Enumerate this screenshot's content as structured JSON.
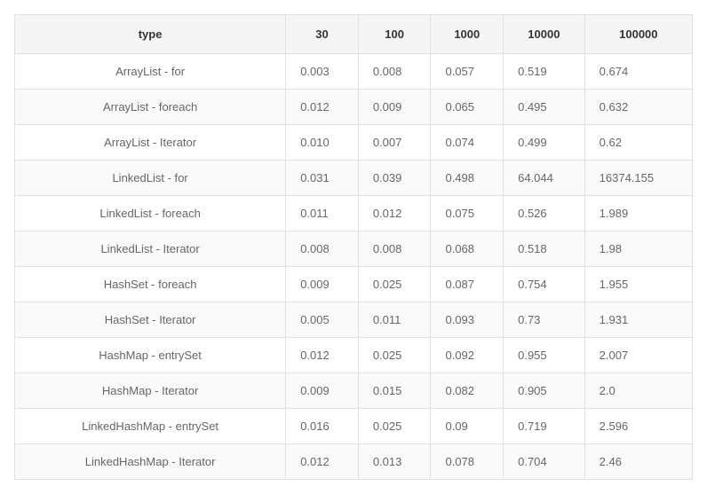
{
  "table": {
    "headers": [
      "type",
      "30",
      "100",
      "1000",
      "10000",
      "100000"
    ],
    "rows": [
      [
        "ArrayList - for",
        "0.003",
        "0.008",
        "0.057",
        "0.519",
        "0.674"
      ],
      [
        "ArrayList - foreach",
        "0.012",
        "0.009",
        "0.065",
        "0.495",
        "0.632"
      ],
      [
        "ArrayList - Iterator",
        "0.010",
        "0.007",
        "0.074",
        "0.499",
        "0.62"
      ],
      [
        "LinkedList - for",
        "0.031",
        "0.039",
        "0.498",
        "64.044",
        "16374.155"
      ],
      [
        "LinkedList - foreach",
        "0.011",
        "0.012",
        "0.075",
        "0.526",
        "1.989"
      ],
      [
        "LinkedList - Iterator",
        "0.008",
        "0.008",
        "0.068",
        "0.518",
        "1.98"
      ],
      [
        "HashSet - foreach",
        "0.009",
        "0.025",
        "0.087",
        "0.754",
        "1.955"
      ],
      [
        "HashSet - Iterator",
        "0.005",
        "0.011",
        "0.093",
        "0.73",
        "1.931"
      ],
      [
        "HashMap - entrySet",
        "0.012",
        "0.025",
        "0.092",
        "0.955",
        "2.007"
      ],
      [
        "HashMap - Iterator",
        "0.009",
        "0.015",
        "0.082",
        "0.905",
        "2.0"
      ],
      [
        "LinkedHashMap - entrySet",
        "0.016",
        "0.025",
        "0.09",
        "0.719",
        "2.596"
      ],
      [
        "LinkedHashMap - Iterator",
        "0.012",
        "0.013",
        "0.078",
        "0.704",
        "2.46"
      ]
    ]
  }
}
